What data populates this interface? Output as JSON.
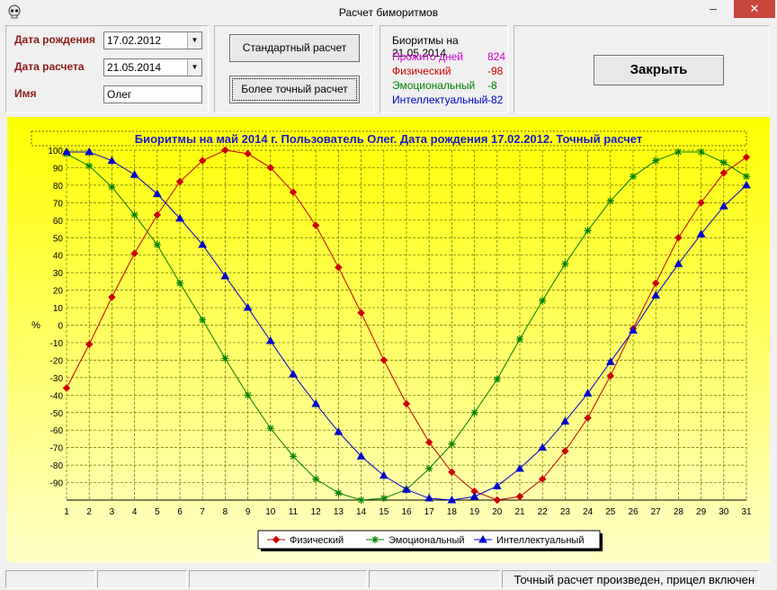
{
  "window": {
    "title": "Расчет биморитмов",
    "minimize_label": "–",
    "close_label": "✕"
  },
  "inputs": {
    "birth_label": "Дата рождения",
    "birth_value": "17.02.2012",
    "calc_label": "Дата расчета",
    "calc_value": "21.05.2014",
    "name_label": "Имя",
    "name_value": "Олег"
  },
  "buttons": {
    "standard": "Стандартный  расчет",
    "precise": "Более точный  расчет",
    "close": "Закрыть"
  },
  "biorhythms": {
    "header": "Биоритмы на 21.05.2014",
    "rows": [
      {
        "label": "Прожито дней",
        "value": "824",
        "color": "#cc00cc"
      },
      {
        "label": "Физический",
        "value": "-98",
        "color": "#cc0000"
      },
      {
        "label": "Эмоциональный",
        "value": "-8",
        "color": "#008000"
      },
      {
        "label": "Интеллектуальный",
        "value": "-82",
        "color": "#0000cc"
      }
    ]
  },
  "chart_data": {
    "type": "line",
    "title": "Биоритмы на май 2014 г. Пользователь Олег. Дата рождения 17.02.2012. Точный расчет",
    "ylabel": "%",
    "xlabel": "",
    "ylim": [
      -100,
      100
    ],
    "xlim": [
      1,
      31
    ],
    "grid": true,
    "legend_position": "bottom",
    "x": [
      1,
      2,
      3,
      4,
      5,
      6,
      7,
      8,
      9,
      10,
      11,
      12,
      13,
      14,
      15,
      16,
      17,
      18,
      19,
      20,
      21,
      22,
      23,
      24,
      25,
      26,
      27,
      28,
      29,
      30,
      31
    ],
    "y_ticks": [
      100,
      90,
      80,
      70,
      60,
      50,
      40,
      30,
      20,
      10,
      0,
      -10,
      -20,
      -30,
      -40,
      -50,
      -60,
      -70,
      -80,
      -90
    ],
    "series": [
      {
        "name": "Физический",
        "color": "#cc0000",
        "marker": "diamond",
        "values": [
          -36,
          -11,
          16,
          41,
          63,
          82,
          94,
          100,
          98,
          90,
          76,
          57,
          33,
          7,
          -20,
          -45,
          -67,
          -84,
          -95,
          -100,
          -98,
          -88,
          -72,
          -53,
          -29,
          -2,
          24,
          50,
          70,
          87,
          96
        ]
      },
      {
        "name": "Эмоциональный",
        "color": "#008000",
        "marker": "star",
        "values": [
          98,
          91,
          79,
          63,
          46,
          24,
          3,
          -19,
          -40,
          -59,
          -75,
          -88,
          -96,
          -100,
          -99,
          -94,
          -82,
          -68,
          -50,
          -31,
          -8,
          14,
          35,
          54,
          71,
          85,
          94,
          99,
          99,
          93,
          85
        ]
      },
      {
        "name": "Интеллектуальный",
        "color": "#0000cc",
        "marker": "triangle",
        "values": [
          99,
          99,
          94,
          86,
          75,
          61,
          46,
          28,
          10,
          -9,
          -28,
          -45,
          -61,
          -75,
          -86,
          -94,
          -99,
          -100,
          -98,
          -92,
          -82,
          -70,
          -55,
          -39,
          -21,
          -3,
          17,
          35,
          52,
          68,
          80
        ]
      }
    ]
  },
  "status": {
    "message": "Точный расчет произведен, прицел включен"
  }
}
